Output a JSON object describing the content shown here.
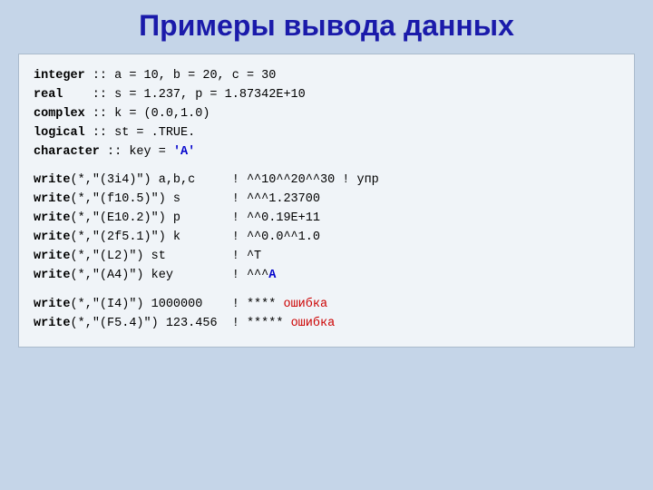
{
  "page": {
    "title": "Примеры вывода данных",
    "code_blocks": [
      {
        "id": "declarations",
        "lines": [
          {
            "id": "int-decl",
            "text": "integer :: a = 10, b = 20, c = 30"
          },
          {
            "id": "real-decl",
            "text": "real    :: s = 1.237, p = 1.87342E+10"
          },
          {
            "id": "complex-decl",
            "text": "complex :: k = (0.0,1.0)"
          },
          {
            "id": "logical-decl",
            "text": "logical :: st = .TRUE."
          },
          {
            "id": "char-decl-prefix",
            "text": "character :: key = "
          },
          {
            "id": "char-decl-value",
            "text": "'A'"
          }
        ]
      },
      {
        "id": "write-calls",
        "lines": [
          {
            "id": "w1",
            "write_part": "write(*,\"(3i4)\") a,b,c",
            "comment": "! ^^10^^20^^30 ! упр"
          },
          {
            "id": "w2",
            "write_part": "write(*,\"(f10.5)\") s",
            "comment": "! ^^^1.23700"
          },
          {
            "id": "w3",
            "write_part": "write(*,\"(E10.2)\") p",
            "comment": "! ^^0.19E+11"
          },
          {
            "id": "w4",
            "write_part": "write(*,\"(2f5.1)\") k",
            "comment": "! ^^0.0^^1.0"
          },
          {
            "id": "w5",
            "write_part": "write(*,\"(L2)\") st",
            "comment": "! ^T"
          },
          {
            "id": "w6",
            "write_part": "write(*,\"(A4)\") key",
            "comment": "! ^^^A"
          }
        ]
      },
      {
        "id": "error-calls",
        "lines": [
          {
            "id": "e1",
            "write_part": "write(*,\"(I4)\") 1000000",
            "comment_normal": "! **** ",
            "comment_error": "ошибка"
          },
          {
            "id": "e2",
            "write_part": "write(*,\"(F5.4)\") 123.456",
            "comment_normal": "! ***** ",
            "comment_error": "ошибка"
          }
        ]
      }
    ]
  }
}
